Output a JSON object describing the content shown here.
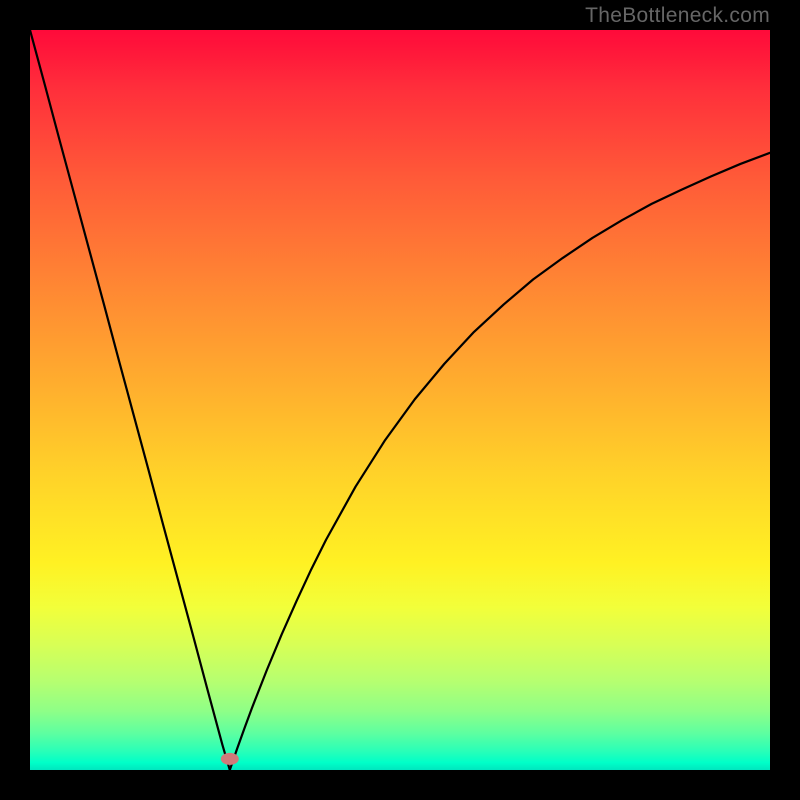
{
  "watermark": "TheBottleneck.com",
  "chart_data": {
    "type": "line",
    "title": "",
    "xlabel": "",
    "ylabel": "",
    "xlim": [
      0,
      100
    ],
    "ylim": [
      0,
      100
    ],
    "grid": false,
    "legend": false,
    "background_gradient": {
      "top_color": "#ff0a3a",
      "bottom_color": "#00e6bf",
      "stops": [
        "red",
        "orange",
        "yellow",
        "green"
      ]
    },
    "marker": {
      "x": 27,
      "y": 1.5,
      "color": "#cf7a7a",
      "rx": 9,
      "ry": 6
    },
    "series": [
      {
        "name": "bottleneck-curve",
        "color": "#000000",
        "x": [
          0,
          2,
          4,
          6,
          8,
          10,
          12,
          14,
          16,
          18,
          20,
          22,
          24,
          25,
          26,
          27,
          28,
          29,
          30,
          32,
          34,
          36,
          38,
          40,
          44,
          48,
          52,
          56,
          60,
          64,
          68,
          72,
          76,
          80,
          84,
          88,
          92,
          96,
          100
        ],
        "values": [
          100,
          92.6,
          85.1,
          77.7,
          70.3,
          62.9,
          55.4,
          48.0,
          40.6,
          33.1,
          25.7,
          18.3,
          10.8,
          7.1,
          3.4,
          0.0,
          2.9,
          5.7,
          8.4,
          13.5,
          18.3,
          22.8,
          27.1,
          31.1,
          38.3,
          44.6,
          50.1,
          54.9,
          59.2,
          62.9,
          66.3,
          69.2,
          71.9,
          74.3,
          76.5,
          78.4,
          80.2,
          81.9,
          83.4
        ]
      }
    ]
  }
}
